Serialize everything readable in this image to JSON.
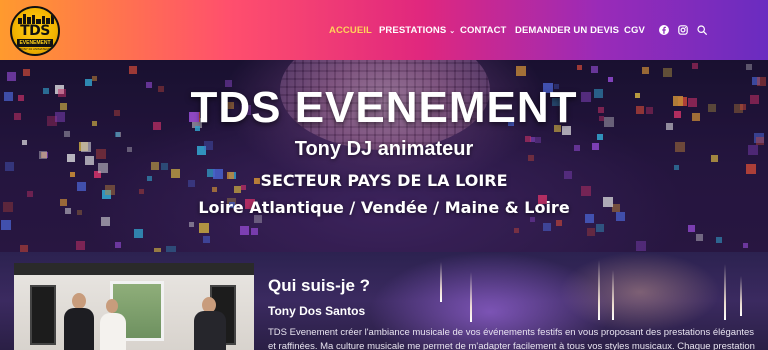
{
  "logo": {
    "main": "TDS",
    "sub": "EVENEMENT",
    "tagline": "TONY DJ ANIMATEUR"
  },
  "nav": {
    "items": [
      {
        "label": "ACCUEIL",
        "active": true
      },
      {
        "label": "PRESTATIONS",
        "dropdown": true
      },
      {
        "label": "CONTACT"
      },
      {
        "label": "DEMANDER UN DEVIS"
      },
      {
        "label": "CGV"
      }
    ],
    "chevron": "›",
    "social": [
      "facebook-icon",
      "instagram-icon",
      "search-icon"
    ],
    "active_color": "#ffd35a"
  },
  "hero": {
    "title": "TDS EVENEMENT",
    "line1": "Tony DJ animateur",
    "line2": "SECTEUR PAYS DE LA LOIRE",
    "line3": "Loire Atlantique / Vendée / Maine & Loire"
  },
  "about": {
    "title": "Qui suis-je ?",
    "name": "Tony Dos Santos",
    "text": "TDS Evenement créer l'ambiance musicale de vos événements festifs en vous proposant des prestations élégantes et raffinées. Ma culture musicale me permet de m'adapter facilement à tous vos styles musicaux. Chaque prestation"
  }
}
